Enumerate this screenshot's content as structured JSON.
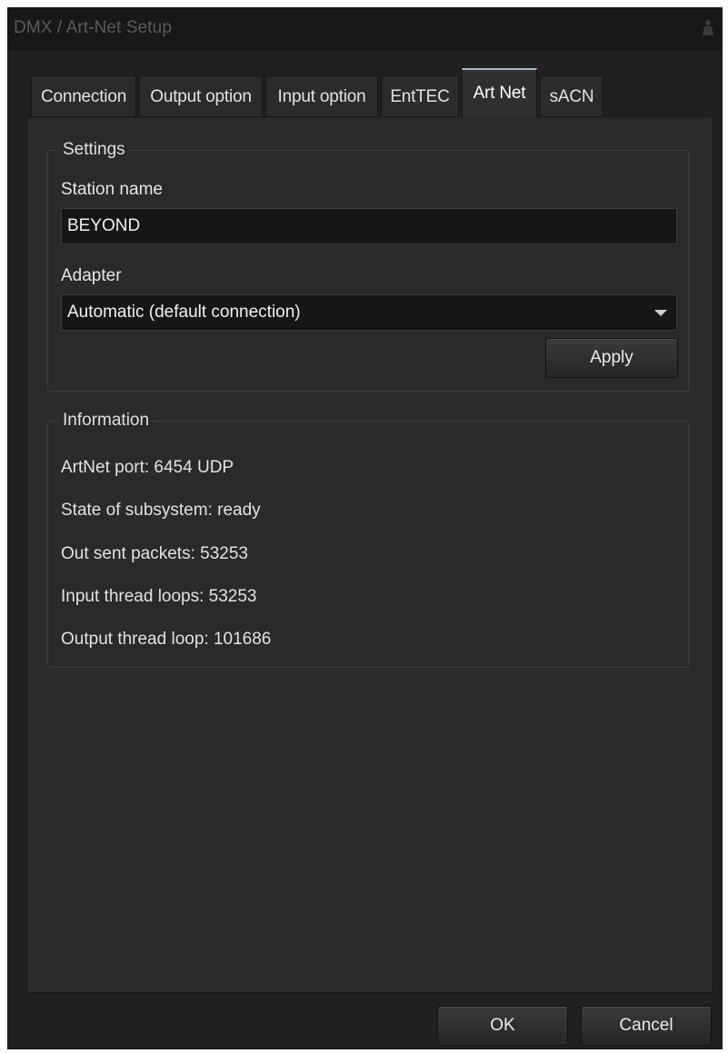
{
  "window": {
    "title": "DMX / Art-Net Setup"
  },
  "tabs": [
    {
      "label": "Connection",
      "active": false
    },
    {
      "label": "Output option",
      "active": false
    },
    {
      "label": "Input option",
      "active": false
    },
    {
      "label": "EntTEC",
      "active": false
    },
    {
      "label": "Art Net",
      "active": true
    },
    {
      "label": "sACN",
      "active": false
    }
  ],
  "settings": {
    "group_title": "Settings",
    "station_name_label": "Station name",
    "station_name_value": "BEYOND",
    "adapter_label": "Adapter",
    "adapter_value": "Automatic (default connection)",
    "apply_label": "Apply"
  },
  "information": {
    "group_title": "Information",
    "lines": [
      "ArtNet port: 6454 UDP",
      "State of subsystem: ready",
      "Out sent packets: 53253",
      "Input thread loops: 53253",
      "Output thread loop: 101686"
    ]
  },
  "footer": {
    "ok_label": "OK",
    "cancel_label": "Cancel"
  },
  "icons": {
    "title_icon": "lamp-icon"
  }
}
